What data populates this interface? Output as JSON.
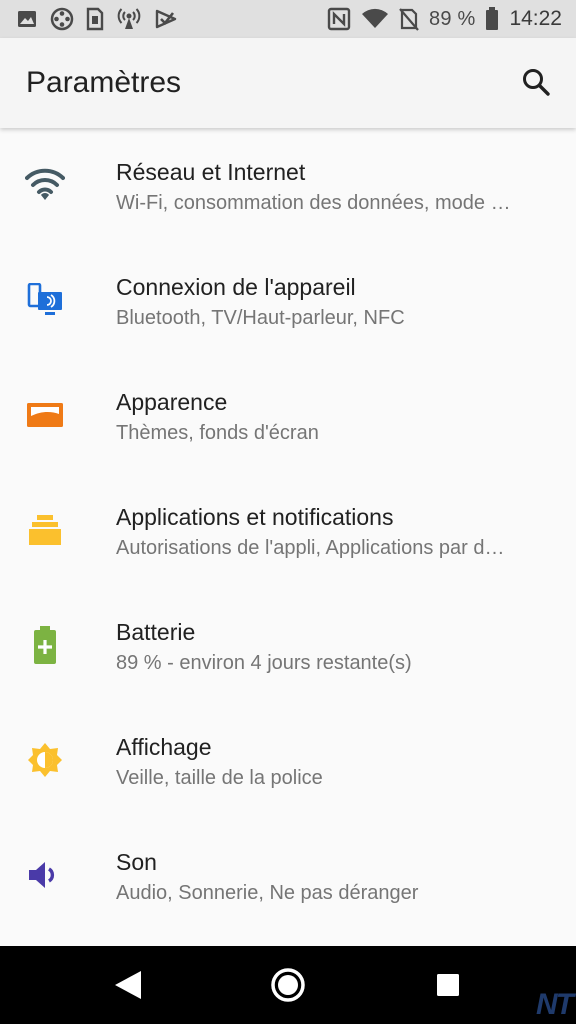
{
  "status_bar": {
    "left_icons": [
      "image-icon",
      "film-reel-icon",
      "sim-card-icon",
      "hotspot-icon",
      "play-store-icon"
    ],
    "right_icons": [
      "nfc-icon",
      "wifi-icon",
      "no-sim-icon",
      "battery-icon"
    ],
    "battery_text": "89 %",
    "battery_level": 0.89,
    "time": "14:22"
  },
  "app_bar": {
    "title": "Paramètres",
    "search_icon": "search-icon"
  },
  "settings": [
    {
      "title": "Réseau et Internet",
      "subtitle": "Wi-Fi, consommation des données, mode …",
      "icon": "wifi-icon",
      "color": "#455a64"
    },
    {
      "title": "Connexion de l'appareil",
      "subtitle": "Bluetooth, TV/Haut-parleur, NFC",
      "icon": "device-connection-icon",
      "color": "#1e6fd9"
    },
    {
      "title": "Apparence",
      "subtitle": "Thèmes, fonds d'écran",
      "icon": "wallpaper-icon",
      "color": "#ef7a16"
    },
    {
      "title": "Applications et notifications",
      "subtitle": "Autorisations de l'appli, Applications par d…",
      "icon": "apps-stack-icon",
      "color": "#fbc02d"
    },
    {
      "title": "Batterie",
      "subtitle": "89 % - environ 4 jours restante(s)",
      "icon": "battery-plus-icon",
      "color": "#7cb342"
    },
    {
      "title": "Affichage",
      "subtitle": "Veille, taille de la police",
      "icon": "brightness-icon",
      "color": "#fbc02d"
    },
    {
      "title": "Son",
      "subtitle": "Audio, Sonnerie, Ne pas déranger",
      "icon": "volume-icon",
      "color": "#4a3aa8"
    }
  ],
  "nav_bar": {
    "buttons": [
      "back-icon",
      "home-icon",
      "recents-icon"
    ]
  },
  "watermark": "NT"
}
